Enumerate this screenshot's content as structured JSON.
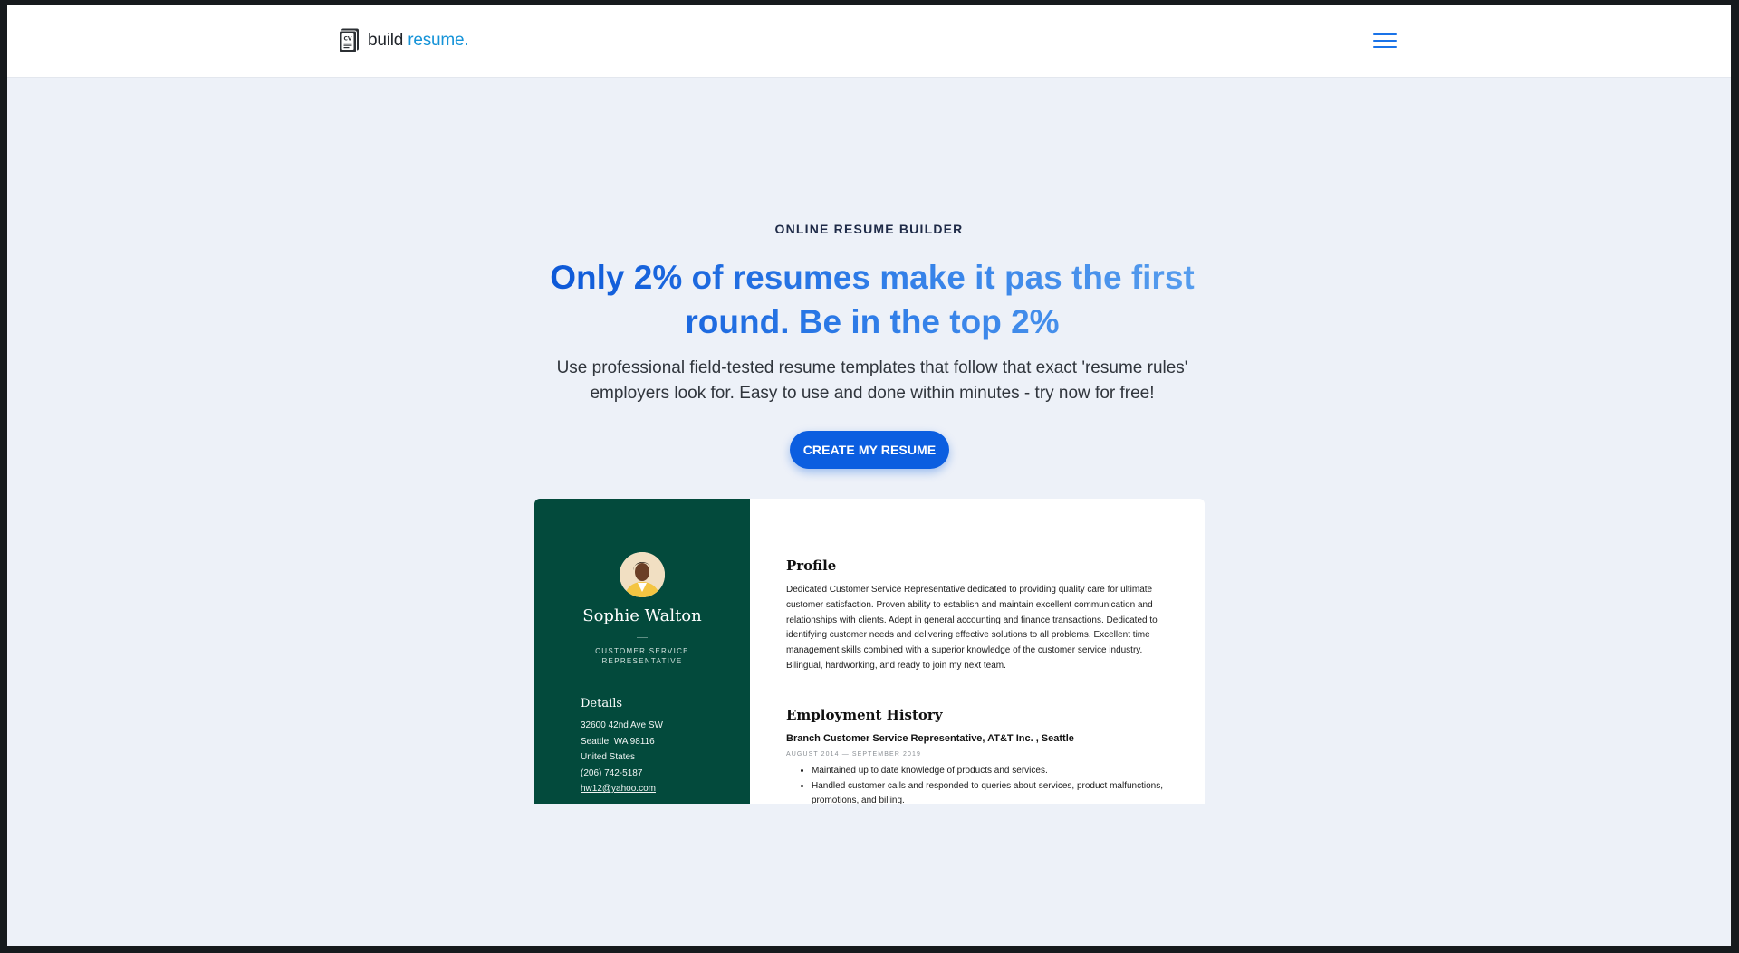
{
  "header": {
    "logo_word1": "build",
    "logo_word2": "resume.",
    "logo_icon": "cv-document-icon",
    "menu_icon": "hamburger-menu-icon"
  },
  "hero": {
    "eyebrow": "ONLINE RESUME BUILDER",
    "headline": "Only 2% of resumes make it pas the first round. Be in the top 2%",
    "subtext": "Use professional field-tested resume templates that follow that exact 'resume rules' employers look for. Easy to use and done within minutes - try now for free!",
    "cta_label": "CREATE MY RESUME"
  },
  "resume_preview": {
    "name": "Sophie Walton",
    "job_title": "CUSTOMER SERVICE REPRESENTATIVE",
    "details_heading": "Details",
    "details": {
      "address1": "32600 42nd Ave SW",
      "address2": "Seattle, WA 98116",
      "country": "United States",
      "phone": "(206) 742-5187",
      "email": "hw12@yahoo.com"
    },
    "profile_heading": "Profile",
    "profile_text": "Dedicated Customer Service Representative dedicated to providing quality care for ultimate customer satisfaction. Proven ability to establish and maintain excellent communication and relationships with clients. Adept in general accounting and finance transactions. Dedicated to identifying customer needs and delivering effective solutions to all problems. Excellent time management skills combined with a superior knowledge of the customer service industry. Bilingual, hardworking, and ready to join my next team.",
    "employment_heading": "Employment History",
    "job_line": "Branch Customer Service Representative, AT&T Inc. , Seattle",
    "job_dates": "AUGUST 2014 — SEPTEMBER 2019",
    "bullets": [
      "Maintained up to date knowledge of products and services.",
      "Handled customer calls and responded to queries about services, product malfunctions, promotions, and billing."
    ]
  },
  "colors": {
    "page_background": "#edf1f8",
    "cta_blue": "#0b5ee0",
    "logo_accent": "#1593d8",
    "sidebar_green": "#034a3c"
  }
}
